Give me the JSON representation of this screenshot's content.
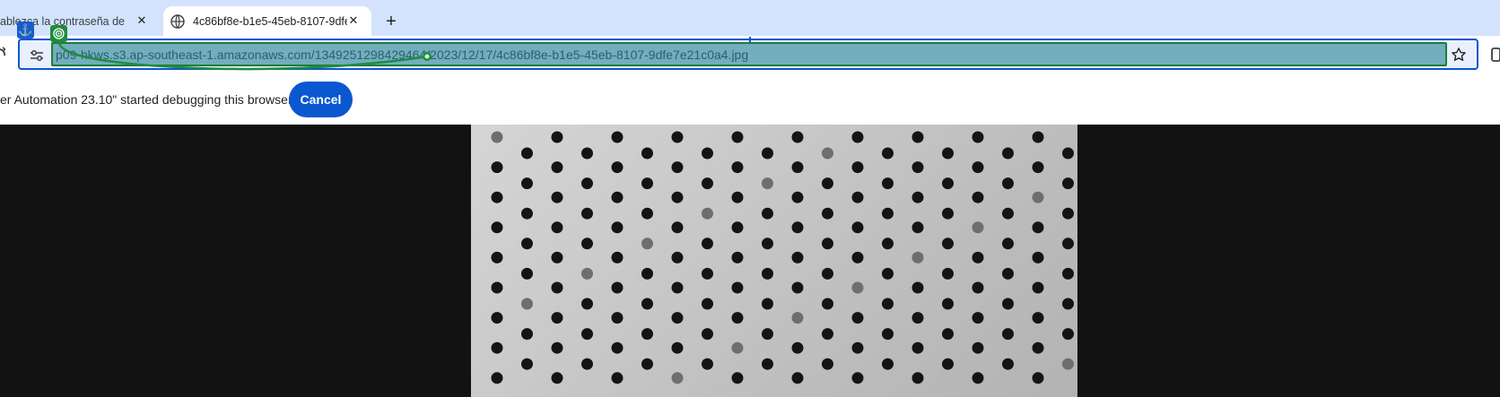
{
  "tabs": [
    {
      "title": "ablezca la contraseña de ac",
      "active": false,
      "close_glyph": "✕"
    },
    {
      "title": "4c86bf8e-b1e5-45eb-8107-9dfe",
      "active": true,
      "close_glyph": "✕",
      "icon": "globe-icon"
    }
  ],
  "new_tab_glyph": "+",
  "toolbar": {
    "url": "p09-hkws.s3.ap-southeast-1.amazonaws.com/134925129842946​4/2023/12/17/4c86bf8e-b1e5-45eb-8107-9dfe7e21c0a4.jpg",
    "site_info_icon": "tune-icon",
    "bookmark_icon": "star-icon"
  },
  "overlays": {
    "anchor_glyph": "⚓",
    "target_icon": "target-icon"
  },
  "infobar": {
    "message": "er Automation 23.10\" started debugging this browser",
    "cancel_label": "Cancel"
  },
  "colors": {
    "tabstrip": "#d3e3fd",
    "accent": "#0b57d0",
    "url_highlight": "#72aebb",
    "annotation_green": "#1e8c3e",
    "viewer_bg": "#121212"
  }
}
